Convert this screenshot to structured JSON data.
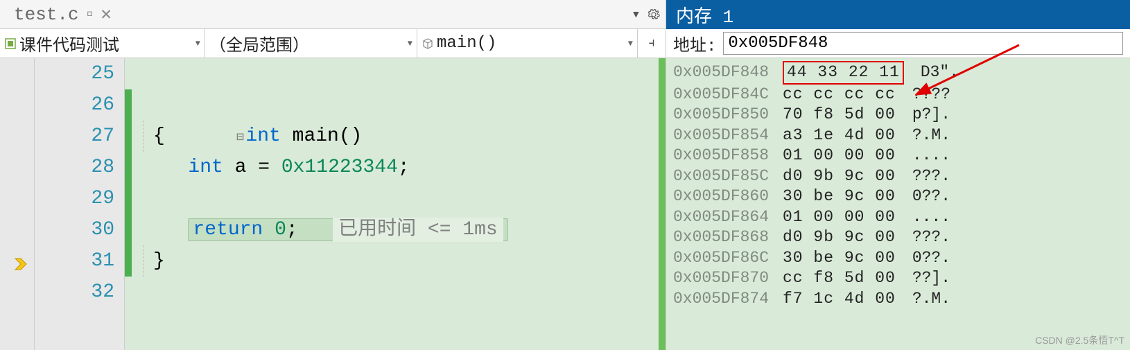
{
  "tab": {
    "filename": "test.c",
    "pinned": true
  },
  "selectors": {
    "project": "课件代码测试",
    "scope": "（全局范围）",
    "function": "main()"
  },
  "editor": {
    "line_numbers": [
      "25",
      "26",
      "27",
      "28",
      "29",
      "30",
      "31",
      "32"
    ],
    "execution_line": 30,
    "code": {
      "l26_kw": "int",
      "l26_rest": " main()",
      "l27": "{",
      "l28_kw": "int",
      "l28_rest": " a = ",
      "l28_val": "0x11223344",
      "l28_semi": ";",
      "l30_kw": "return",
      "l30_rest": " ",
      "l30_val": "0",
      "l30_semi": ";",
      "l31": "}",
      "perf_hint": "已用时间 <= 1ms"
    }
  },
  "memory": {
    "panel_title": "内存 1",
    "address_label": "地址:",
    "address_value": "0x005DF848",
    "rows": [
      {
        "addr": "0x005DF848",
        "bytes": "44 33 22 11",
        "ascii": "D3\".",
        "highlight": true
      },
      {
        "addr": "0x005DF84C",
        "bytes": "cc cc cc cc",
        "ascii": "????"
      },
      {
        "addr": "0x005DF850",
        "bytes": "70 f8 5d 00",
        "ascii": "p?]."
      },
      {
        "addr": "0x005DF854",
        "bytes": "a3 1e 4d 00",
        "ascii": "?.M."
      },
      {
        "addr": "0x005DF858",
        "bytes": "01 00 00 00",
        "ascii": "...."
      },
      {
        "addr": "0x005DF85C",
        "bytes": "d0 9b 9c 00",
        "ascii": "???."
      },
      {
        "addr": "0x005DF860",
        "bytes": "30 be 9c 00",
        "ascii": "0??."
      },
      {
        "addr": "0x005DF864",
        "bytes": "01 00 00 00",
        "ascii": "...."
      },
      {
        "addr": "0x005DF868",
        "bytes": "d0 9b 9c 00",
        "ascii": "???."
      },
      {
        "addr": "0x005DF86C",
        "bytes": "30 be 9c 00",
        "ascii": "0??."
      },
      {
        "addr": "0x005DF870",
        "bytes": "cc f8 5d 00",
        "ascii": "??]."
      },
      {
        "addr": "0x005DF874",
        "bytes": "f7 1c 4d 00",
        "ascii": "?.M."
      }
    ]
  },
  "watermark": "CSDN @2.5条悟T^T"
}
